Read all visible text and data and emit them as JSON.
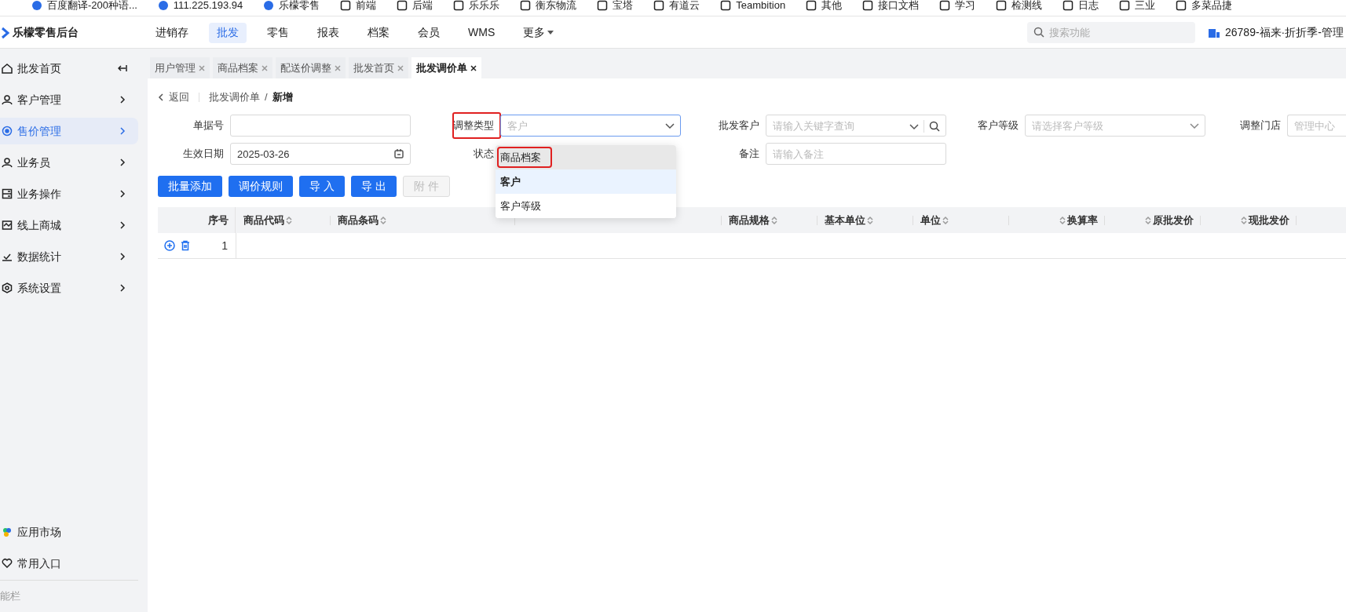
{
  "bookmarks": [
    "百度翻译-200种语...",
    "111.225.193.94",
    "乐檬零售",
    "前端",
    "后端",
    "乐乐乐",
    "衡东物流",
    "宝塔",
    "有道云",
    "Teambition",
    "其他",
    "接口文档",
    "学习",
    "检测线",
    "日志",
    "三业",
    "多菜品捷"
  ],
  "header": {
    "logo": "乐檬零售后台",
    "nav": [
      {
        "label": "进销存",
        "selected": false
      },
      {
        "label": "批发",
        "selected": true
      },
      {
        "label": "零售",
        "selected": false
      },
      {
        "label": "报表",
        "selected": false
      },
      {
        "label": "档案",
        "selected": false
      },
      {
        "label": "会员",
        "selected": false
      },
      {
        "label": "WMS",
        "selected": false
      },
      {
        "label": "更多",
        "selected": false,
        "has_menu": true
      }
    ],
    "search": {
      "placeholder": "搜索功能"
    },
    "store": "26789-福来·折折季-管理"
  },
  "sidebar": {
    "items": [
      {
        "label": "批发首页",
        "selected": false,
        "kind": "collapse"
      },
      {
        "label": "客户管理",
        "selected": false,
        "kind": "expand"
      },
      {
        "label": "售价管理",
        "selected": true,
        "kind": "expand"
      },
      {
        "label": "业务员",
        "selected": false,
        "kind": "expand"
      },
      {
        "label": "业务操作",
        "selected": false,
        "kind": "expand"
      },
      {
        "label": "线上商城",
        "selected": false,
        "kind": "expand"
      },
      {
        "label": "数据统计",
        "selected": false,
        "kind": "expand"
      },
      {
        "label": "系统设置",
        "selected": false,
        "kind": "expand"
      }
    ],
    "bottom": [
      "应用市场",
      "常用入口"
    ],
    "footer": "能栏"
  },
  "tabs": [
    {
      "label": "用户管理",
      "selected": false
    },
    {
      "label": "商品档案",
      "selected": false
    },
    {
      "label": "配送价调整",
      "selected": false
    },
    {
      "label": "批发首页",
      "selected": false
    },
    {
      "label": "批发调价单",
      "selected": true
    }
  ],
  "breadcrumb": {
    "back": "返回",
    "parent": "批发调价单",
    "separator": "/",
    "current": "新增"
  },
  "form": {
    "doc_no": {
      "label": "单据号"
    },
    "adjust_type": {
      "label": "调整类型",
      "placeholder": "客户",
      "highlighted": true
    },
    "customer": {
      "label": "批发客户",
      "placeholder": "请输入关键字查询"
    },
    "level": {
      "label": "客户等级",
      "placeholder": "请选择客户等级"
    },
    "store": {
      "label": "调整门店",
      "placeholder": "管理中心"
    },
    "date": {
      "label": "生效日期",
      "value": "2025-03-26"
    },
    "status": {
      "label": "状态"
    },
    "remark": {
      "label": "备注",
      "placeholder": "请输入备注"
    }
  },
  "dropdown": [
    {
      "label": "商品档案",
      "selected": false,
      "hovered": true,
      "highlighted": true
    },
    {
      "label": "客户",
      "selected": true,
      "hovered": false,
      "highlighted": false
    },
    {
      "label": "客户等级",
      "selected": false,
      "hovered": false,
      "highlighted": false
    }
  ],
  "buttons": [
    {
      "label": "批量添加",
      "disabled": false
    },
    {
      "label": "调价规则",
      "disabled": false
    },
    {
      "label": "导 入",
      "disabled": false
    },
    {
      "label": "导 出",
      "disabled": false
    },
    {
      "label": "附 件",
      "disabled": true
    }
  ],
  "table": {
    "columns": [
      {
        "label": "序号",
        "sortable": false
      },
      {
        "label": "商品代码",
        "sortable": true
      },
      {
        "label": "商品条码",
        "sortable": true
      },
      {
        "label": "商品规格",
        "sortable": true
      },
      {
        "label": "基本单位",
        "sortable": true
      },
      {
        "label": "单位",
        "sortable": true
      },
      {
        "label": "换算率",
        "sortable": true
      },
      {
        "label": "原批发价",
        "sortable": true
      },
      {
        "label": "现批发价",
        "sortable": true
      }
    ],
    "rows": [
      {
        "index": "1"
      }
    ]
  }
}
